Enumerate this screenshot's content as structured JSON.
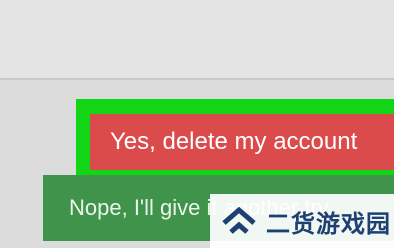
{
  "dialog": {
    "delete_button_label": "Yes, delete my account",
    "cancel_button_label": "Nope, I'll give it another try"
  },
  "watermark": {
    "text": "二货游戏园",
    "icon": "double-chevron-logo-icon"
  },
  "colors": {
    "highlight": "#12d515",
    "delete_button": "#dc4b4b",
    "cancel_button": "#3f934a",
    "background": "#dcdcdc"
  }
}
